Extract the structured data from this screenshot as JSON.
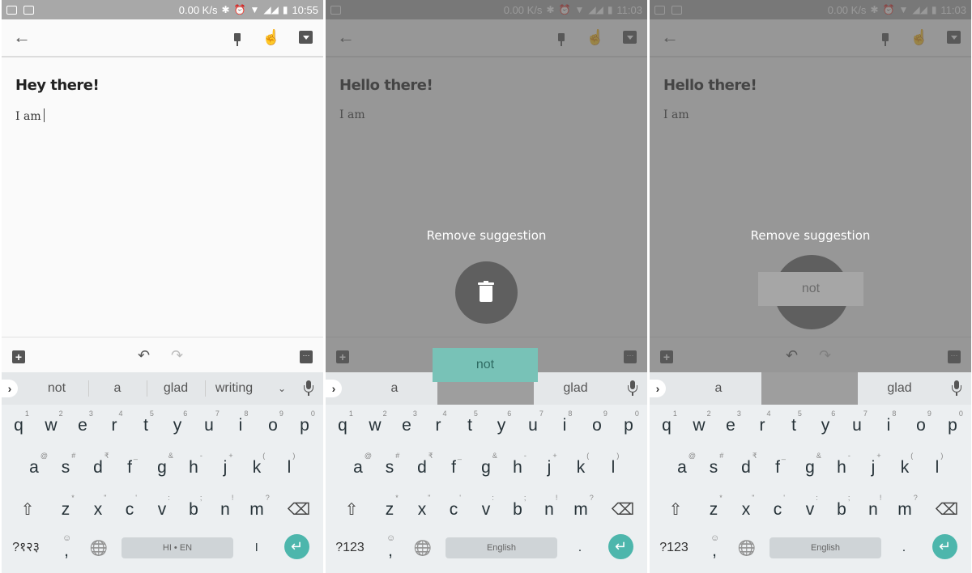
{
  "panels": [
    {
      "status": {
        "speed": "0.00 K/s",
        "time": "10:55"
      },
      "note": {
        "title": "Hey there!",
        "body": "I am"
      },
      "suggestions": [
        "not",
        "a",
        "glad",
        "writing"
      ],
      "keyboard": {
        "symbols_key": "?१२३",
        "space_label": "HI • EN",
        "period_key": "।"
      }
    },
    {
      "status": {
        "speed": "0.00 K/s",
        "time": "11:03"
      },
      "note": {
        "title": "Hello there!",
        "body": "I am"
      },
      "suggestions": [
        "a",
        "glad"
      ],
      "overlay": {
        "label": "Remove suggestion",
        "dragged_word": "not"
      },
      "keyboard": {
        "symbols_key": "?123",
        "space_label": "English",
        "period_key": "."
      }
    },
    {
      "status": {
        "speed": "0.00 K/s",
        "time": "11:03"
      },
      "note": {
        "title": "Hello there!",
        "body": "I am"
      },
      "suggestions": [
        "a",
        "glad"
      ],
      "overlay": {
        "label": "Remove suggestion",
        "dragged_word": "not"
      },
      "keyboard": {
        "symbols_key": "?123",
        "space_label": "English",
        "period_key": "."
      }
    }
  ],
  "keys": {
    "row1": [
      [
        "q",
        "1"
      ],
      [
        "w",
        "2"
      ],
      [
        "e",
        "3"
      ],
      [
        "r",
        "4"
      ],
      [
        "t",
        "5"
      ],
      [
        "y",
        "6"
      ],
      [
        "u",
        "7"
      ],
      [
        "i",
        "8"
      ],
      [
        "o",
        "9"
      ],
      [
        "p",
        "0"
      ]
    ],
    "row2": [
      [
        "a",
        "@"
      ],
      [
        "s",
        "#"
      ],
      [
        "d",
        "₹"
      ],
      [
        "f",
        "_"
      ],
      [
        "g",
        "&"
      ],
      [
        "h",
        "-"
      ],
      [
        "j",
        "+"
      ],
      [
        "k",
        "("
      ],
      [
        "l",
        ")"
      ]
    ],
    "row3": [
      [
        "z",
        "*"
      ],
      [
        "x",
        "\""
      ],
      [
        "c",
        "'"
      ],
      [
        "v",
        ":"
      ],
      [
        "b",
        ";"
      ],
      [
        "n",
        "!"
      ],
      [
        "m",
        "?"
      ]
    ]
  },
  "icons": {
    "back": "←",
    "undo": "↶",
    "redo": "↷",
    "plus": "+",
    "more": "···",
    "expand": "›",
    "chevron": "⌄",
    "shift": "⇧",
    "backspace": "⌫",
    "globe": "🌐",
    "enter": "↵",
    "emoji": "☺",
    "comma": ",",
    "bluetooth": "✱",
    "alarm": "⏰",
    "wifi": "▼",
    "hand": "☝"
  },
  "colors": {
    "accent": "#4db6ac",
    "drag_chip": "#78c2b7",
    "overlay_circle": "#5f5f5f"
  }
}
